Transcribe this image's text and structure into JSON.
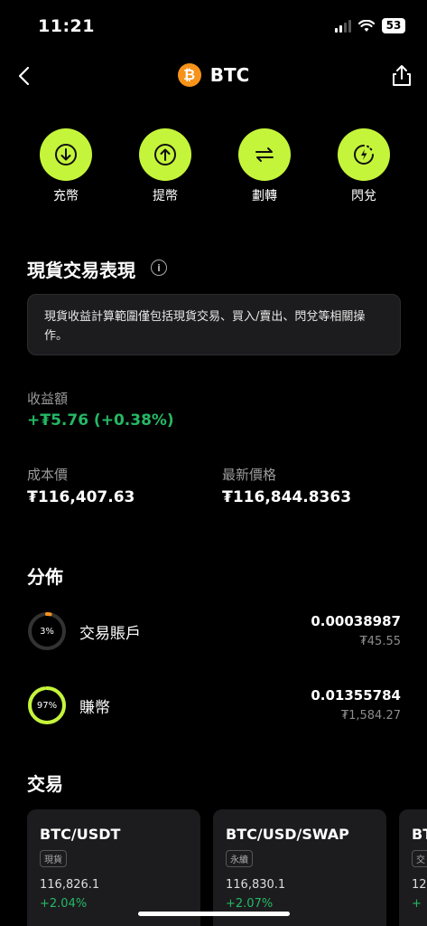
{
  "status": {
    "time": "11:21",
    "battery": "53"
  },
  "header": {
    "coin_logo": "₿",
    "symbol": "BTC"
  },
  "actions": [
    {
      "label": "充幣",
      "icon": "deposit-icon"
    },
    {
      "label": "提幣",
      "icon": "withdraw-icon"
    },
    {
      "label": "劃轉",
      "icon": "transfer-icon"
    },
    {
      "label": "閃兌",
      "icon": "convert-icon"
    }
  ],
  "performance": {
    "title": "現貨交易表現",
    "info_icon": "i",
    "notice": "現貨收益計算範圍僅包括現貨交易、買入/賣出、閃兌等相關操作。",
    "pnl_label": "收益額",
    "pnl_value": "+₮5.76 (+0.38%)",
    "cost_label": "成本價",
    "cost_value": "₮116,407.63",
    "latest_label": "最新價格",
    "latest_value": "₮116,844.8363"
  },
  "distribution": {
    "title": "分佈",
    "rows": [
      {
        "pct_label": "3%",
        "pct": 0.03,
        "name": "交易賬戶",
        "amount": "0.00038987",
        "fiat": "₮45.55",
        "color": "#f7931a"
      },
      {
        "pct_label": "97%",
        "pct": 0.97,
        "name": "賺幣",
        "amount": "0.01355784",
        "fiat": "₮1,584.27",
        "color": "#c5f53a"
      }
    ]
  },
  "trade": {
    "title": "交易",
    "cards": [
      {
        "pair": "BTC/USDT",
        "tag": "現貨",
        "price": "116,826.1",
        "change": "+2.04%"
      },
      {
        "pair": "BTC/USD/SWAP",
        "tag": "永續",
        "price": "116,830.1",
        "change": "+2.07%"
      },
      {
        "pair": "BT",
        "tag": "交",
        "price": "12",
        "change": "+"
      }
    ]
  },
  "colors": {
    "accent": "#c5f53a",
    "positive": "#25b865",
    "btc": "#f7931a"
  }
}
